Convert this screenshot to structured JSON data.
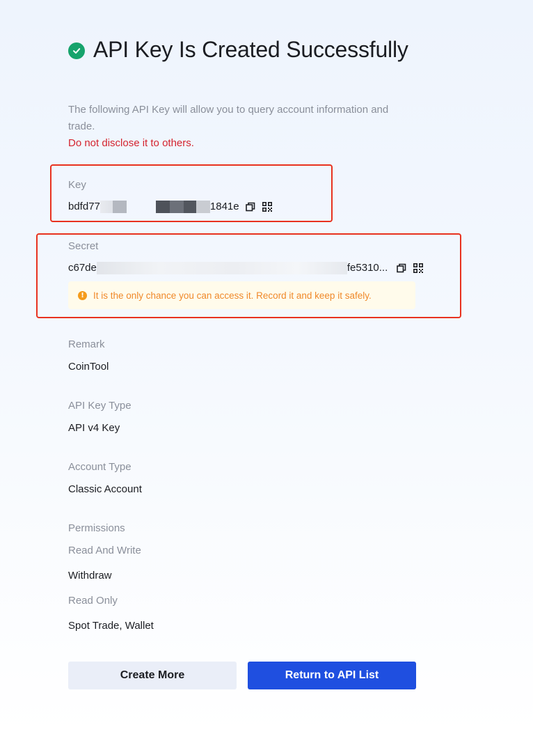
{
  "header": {
    "title": "API Key Is Created Successfully",
    "description": "The following API Key will allow you to query account information and trade.",
    "warning": "Do not disclose it to others."
  },
  "key": {
    "label": "Key",
    "prefix": "bdfd77",
    "suffix": "1841e"
  },
  "secret": {
    "label": "Secret",
    "prefix": "c67de",
    "suffix": "fe5310..."
  },
  "tip": "It is the only chance you can access it. Record it and keep it safely.",
  "fields": {
    "remark_label": "Remark",
    "remark_value": "CoinTool",
    "type_label": "API Key Type",
    "type_value": "API v4 Key",
    "account_label": "Account Type",
    "account_value": "Classic Account",
    "permissions_label": "Permissions",
    "read_write_label": "Read And Write",
    "read_write_value": "Withdraw",
    "read_only_label": "Read Only",
    "read_only_value": "Spot Trade, Wallet"
  },
  "buttons": {
    "create_more": "Create More",
    "return_list": "Return to API List"
  },
  "colors": {
    "success": "#16a36c",
    "danger": "#d4242f",
    "warning": "#f0892a",
    "primary": "#1f4fe0",
    "highlight": "#e8321f"
  }
}
